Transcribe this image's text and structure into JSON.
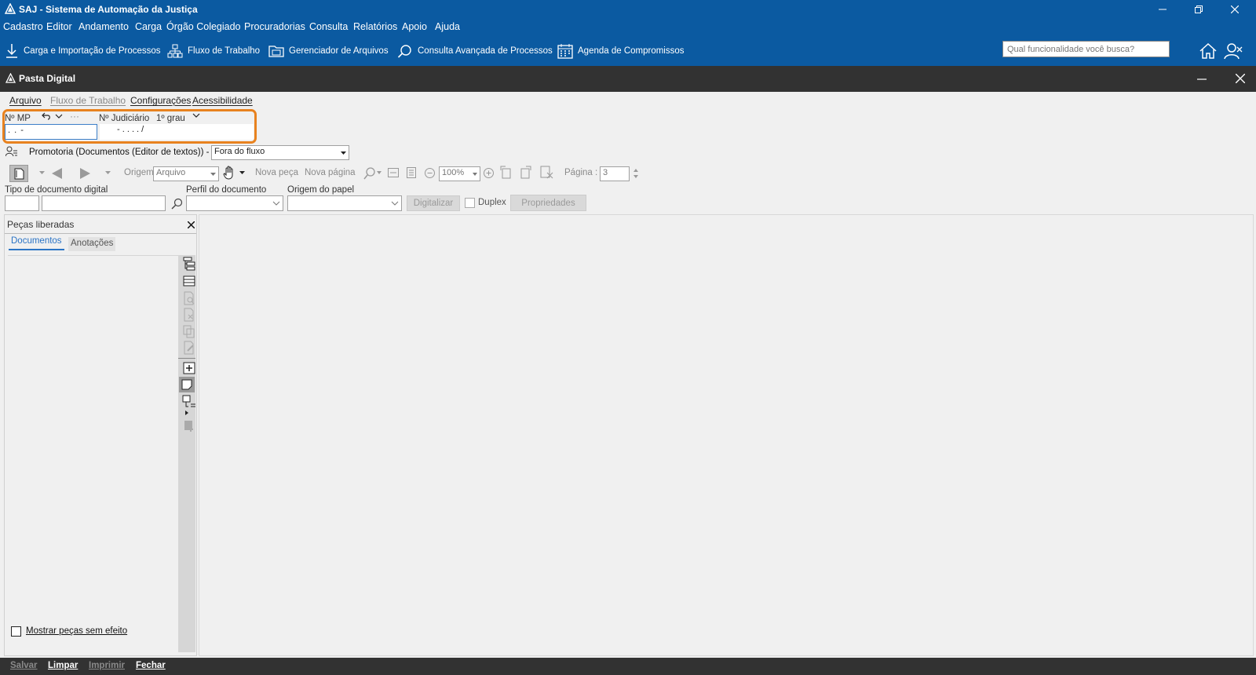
{
  "app": {
    "title": "SAJ - Sistema de Automação da Justiça"
  },
  "menu": {
    "items": [
      "Cadastro",
      "Editor",
      "Andamento",
      "Carga",
      "Órgão Colegiado",
      "Procuradorias",
      "Consulta",
      "Relatórios",
      "Apoio",
      "Ajuda"
    ]
  },
  "toolbar": {
    "items": [
      {
        "label": "Carga e Importação de Processos",
        "icon": "download-icon"
      },
      {
        "label": "Fluxo de Trabalho",
        "icon": "workflow-icon"
      },
      {
        "label": "Gerenciador de Arquivos",
        "icon": "file-manager-icon"
      },
      {
        "label": "Consulta Avançada de Processos",
        "icon": "advanced-search-icon"
      },
      {
        "label": "Agenda de Compromissos",
        "icon": "calendar-icon"
      }
    ],
    "search_placeholder": "Qual funcionalidade você busca?"
  },
  "window": {
    "title": "Pasta Digital",
    "menu": [
      {
        "label": "Arquivo",
        "enabled": true
      },
      {
        "label": "Fluxo de Trabalho",
        "enabled": false
      },
      {
        "label": "Configurações",
        "enabled": true
      },
      {
        "label": "Acessibilidade",
        "enabled": true
      }
    ]
  },
  "process": {
    "mp_label": "Nº MP",
    "mp_value": ".  .     -",
    "judicial_label": "Nº Judiciário",
    "instance_label": "1º grau",
    "judicial_value": "-  .    .  .  .    /"
  },
  "queue": {
    "label": "Promotoria (Documentos (Editor de textos)) - Fila",
    "value": "Fora do fluxo"
  },
  "viewer": {
    "origin_label": "Origem",
    "origin_value": "Arquivo",
    "new_piece": "Nova peça",
    "new_page": "Nova página",
    "zoom": "100%",
    "page_label": "Página :",
    "page_value": "3"
  },
  "scan": {
    "doc_type_label": "Tipo de documento digital",
    "doc_profile_label": "Perfil do documento",
    "paper_origin_label": "Origem do papel",
    "digitize_button": "Digitalizar",
    "duplex_label": "Duplex",
    "properties_button": "Propriedades"
  },
  "left_panel": {
    "title": "Peças liberadas",
    "tabs": [
      "Documentos",
      "Anotações"
    ],
    "show_without_effect": "Mostrar peças sem efeito"
  },
  "bottom": {
    "save": "Salvar",
    "clear": "Limpar",
    "print": "Imprimir",
    "close": "Fechar"
  },
  "colors": {
    "brand": "#0b5aa1",
    "dark": "#323232",
    "highlight": "#e8821f"
  }
}
